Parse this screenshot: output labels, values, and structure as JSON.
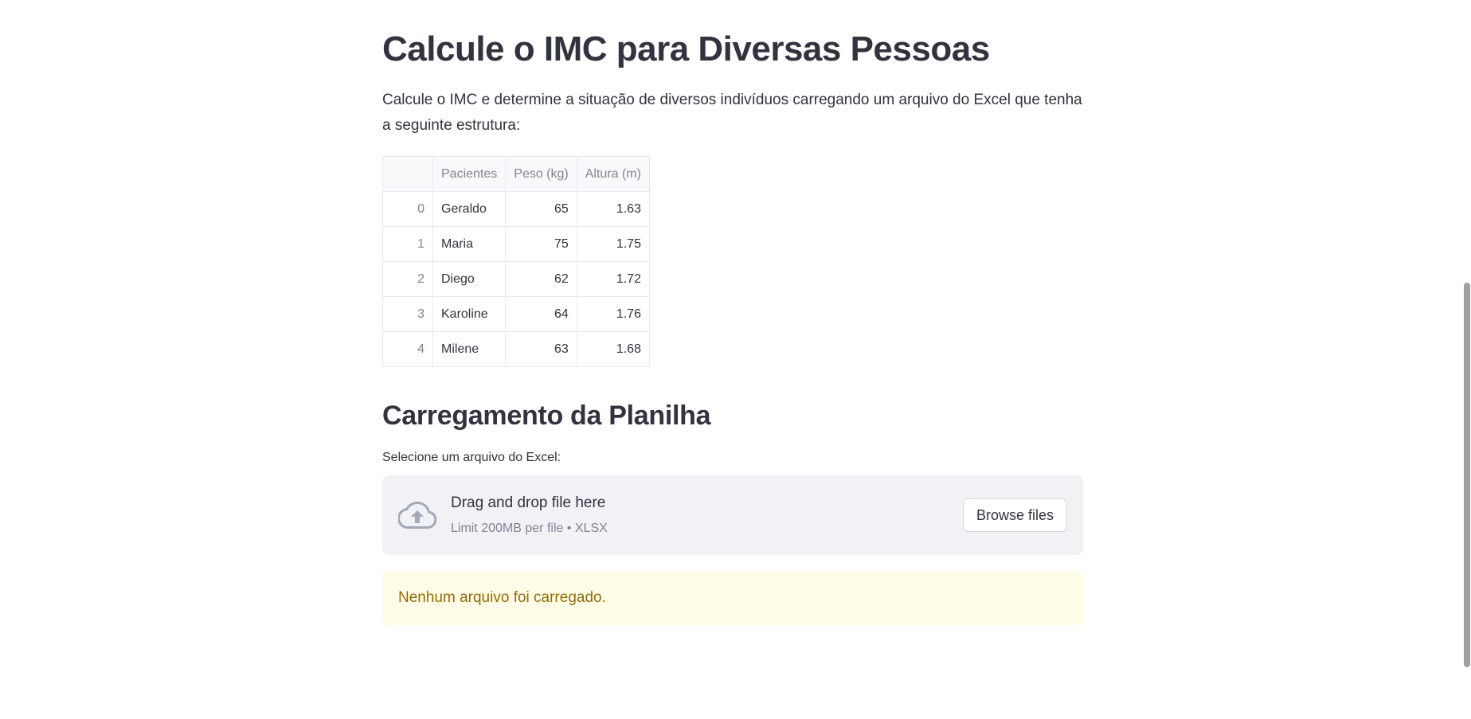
{
  "page": {
    "title": "Calcule o IMC para Diversas Pessoas",
    "description": "Calcule o IMC e determine a situação de diversos indivíduos carregando um arquivo do Excel que tenha a seguinte estrutura:"
  },
  "example_table": {
    "columns": [
      "",
      "Pacientes",
      "Peso (kg)",
      "Altura (m)"
    ],
    "rows": [
      {
        "index": "0",
        "name": "Geraldo",
        "weight": "65",
        "height": "1.63"
      },
      {
        "index": "1",
        "name": "Maria",
        "weight": "75",
        "height": "1.75"
      },
      {
        "index": "2",
        "name": "Diego",
        "weight": "62",
        "height": "1.72"
      },
      {
        "index": "3",
        "name": "Karoline",
        "weight": "64",
        "height": "1.76"
      },
      {
        "index": "4",
        "name": "Milene",
        "weight": "63",
        "height": "1.68"
      }
    ]
  },
  "upload": {
    "section_title": "Carregamento da Planilha",
    "label": "Selecione um arquivo do Excel:",
    "dropzone_title": "Drag and drop file here",
    "dropzone_limit": "Limit 200MB per file • XLSX",
    "browse_label": "Browse files",
    "icon": "cloud-upload-icon"
  },
  "alert": {
    "message": "Nenhum arquivo foi carregado.",
    "color": "#926c05",
    "background": "#fffde7"
  },
  "colors": {
    "text": "#31333f",
    "muted": "#808495",
    "dropzone_bg": "#f0f2f6"
  }
}
